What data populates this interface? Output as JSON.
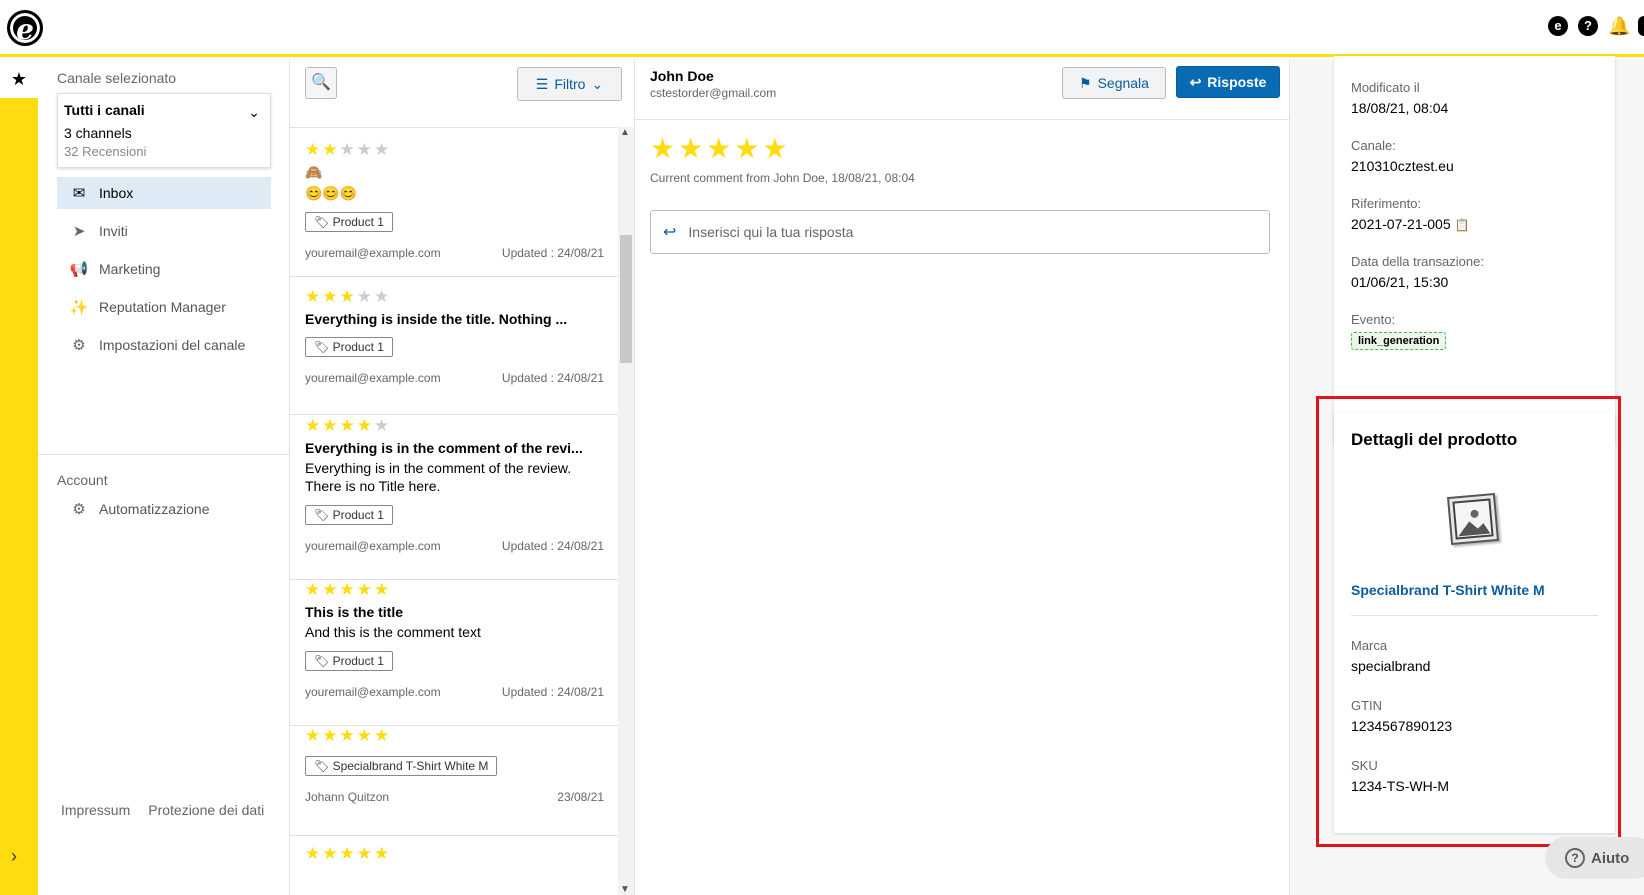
{
  "app": {
    "logo_letter": "e"
  },
  "topbar": {
    "icons": [
      "trusted-shops-icon",
      "help-icon",
      "bell-icon"
    ]
  },
  "nav": {
    "selected_channel_label": "Canale selezionato",
    "channel": {
      "name": "Tutti i canali",
      "count": "3 channels",
      "reviews": "32 Recensioni"
    },
    "items": [
      {
        "label": "Inbox",
        "icon": "inbox-icon",
        "active": true
      },
      {
        "label": "Inviti",
        "icon": "send-icon",
        "active": false
      },
      {
        "label": "Marketing",
        "icon": "megaphone-icon",
        "active": false
      },
      {
        "label": "Reputation Manager",
        "icon": "sparkle-icon",
        "active": false
      },
      {
        "label": "Impostazioni del canale",
        "icon": "gear-icon",
        "active": false
      }
    ],
    "account_label": "Account",
    "account_items": [
      {
        "label": "Automatizzazione",
        "icon": "robot-icon"
      }
    ],
    "footer": {
      "impressum": "Impressum",
      "privacy": "Protezione dei dati"
    }
  },
  "list": {
    "filter_label": "Filtro",
    "reviews": [
      {
        "rating": 2,
        "emoji": "🙈",
        "extra": "😊😊😊",
        "title": "",
        "body": "",
        "tag": "Product 1",
        "email": "youremail@example.com",
        "updated": "Updated : 24/08/21"
      },
      {
        "rating": 3,
        "title": "Everything is inside the title. Nothing ...",
        "body": "",
        "tag": "Product 1",
        "email": "youremail@example.com",
        "updated": "Updated : 24/08/21"
      },
      {
        "rating": 4,
        "title": "Everything is in the comment of the revi...",
        "body": "Everything is in the comment of the review. There is no Title here.",
        "tag": "Product 1",
        "email": "youremail@example.com",
        "updated": "Updated : 24/08/21"
      },
      {
        "rating": 5,
        "title": "This is the title",
        "body": "And this is the comment text",
        "tag": "Product 1",
        "email": "youremail@example.com",
        "updated": "Updated : 24/08/21"
      },
      {
        "rating": 5,
        "title": "",
        "body": "",
        "tag": "Specialbrand T-Shirt White M",
        "email": "Johann Quitzon",
        "updated": "23/08/21"
      },
      {
        "rating": 5,
        "title": "",
        "body": "",
        "tag": "",
        "email": "",
        "updated": ""
      }
    ]
  },
  "detail": {
    "name": "John Doe",
    "email": "cstestorder@gmail.com",
    "flag_label": "Segnala",
    "reply_label": "Risposte",
    "rating": 5,
    "comment_meta": "Current comment from John Doe, 18/08/21, 08:04",
    "reply_placeholder": "Inserisci qui la tua risposta"
  },
  "info": {
    "modified_label": "Modificato il",
    "modified_value": "18/08/21, 08:04",
    "channel_label": "Canale:",
    "channel_value": "210310cztest.eu",
    "reference_label": "Riferimento:",
    "reference_value": "2021-07-21-005",
    "transaction_label": "Data della transazione:",
    "transaction_value": "01/06/21, 15:30",
    "event_label": "Evento:",
    "event_value": "link_generation"
  },
  "product": {
    "title": "Dettagli del prodotto",
    "name": "Specialbrand T-Shirt White M",
    "brand_label": "Marca",
    "brand_value": "specialbrand",
    "gtin_label": "GTIN",
    "gtin_value": "1234567890123",
    "sku_label": "SKU",
    "sku_value": "1234-TS-WH-M"
  },
  "help": {
    "label": "Aiuto"
  },
  "colors": {
    "brand_yellow": "#FFDC0F",
    "primary_blue": "#0A6BB5",
    "highlight_red": "#E1141E"
  }
}
